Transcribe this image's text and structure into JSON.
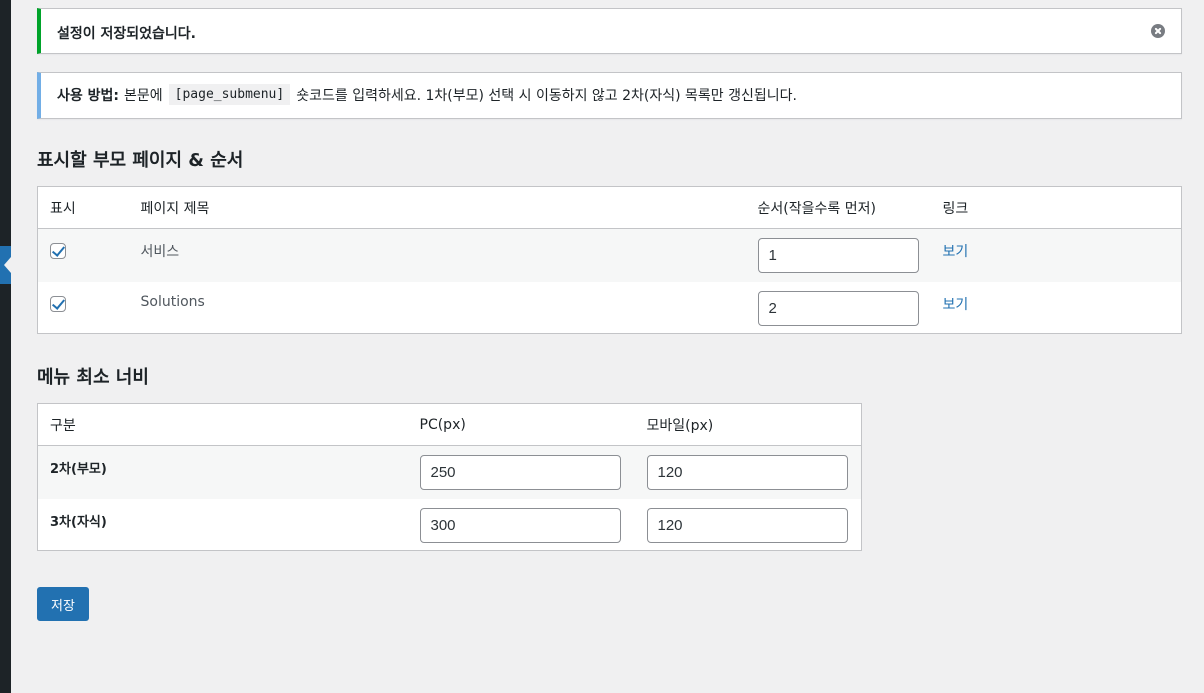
{
  "notices": {
    "success": "설정이 저장되었습니다.",
    "info": {
      "label": "사용 방법:",
      "before_code": "본문에",
      "code": "[page_submenu]",
      "after_code": "숏코드를 입력하세요. 1차(부모) 선택 시 이동하지 않고 2차(자식) 목록만 갱신됩니다."
    }
  },
  "pages_section": {
    "title": "표시할 부모 페이지 & 순서",
    "headers": [
      "표시",
      "페이지 제목",
      "순서(작을수록 먼저)",
      "링크"
    ],
    "rows": [
      {
        "checked": true,
        "title": "서비스",
        "order": "1",
        "link": "보기"
      },
      {
        "checked": true,
        "title": "Solutions",
        "order": "2",
        "link": "보기"
      }
    ]
  },
  "width_section": {
    "title": "메뉴 최소 너비",
    "headers": [
      "구분",
      "PC(px)",
      "모바일(px)"
    ],
    "rows": [
      {
        "label": "2차(부모)",
        "pc": "250",
        "mobile": "120"
      },
      {
        "label": "3차(자식)",
        "pc": "300",
        "mobile": "120"
      }
    ]
  },
  "save_label": "저장",
  "colors": {
    "accent": "#2271b1",
    "success": "#00a32a",
    "info": "#72aee6",
    "background": "#f0f0f1"
  },
  "icons": {
    "dismiss": "dismiss-icon",
    "menu_arrow": "menu-arrow-icon"
  }
}
